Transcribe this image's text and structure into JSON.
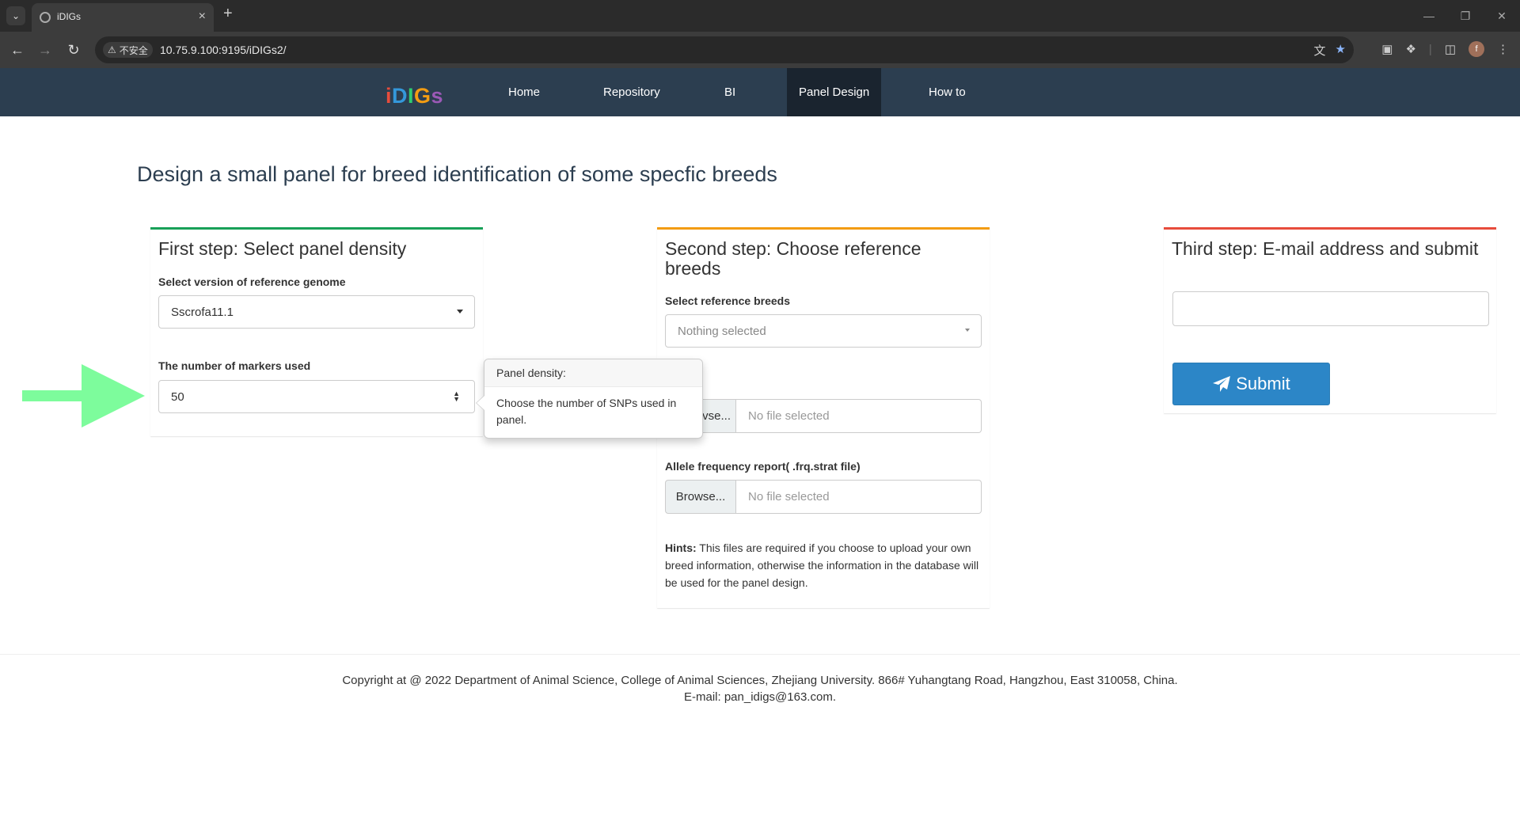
{
  "browser": {
    "tab_title": "iDIGs",
    "security_label": "不安全",
    "url": "10.75.9.100:9195/iDIGs2/",
    "avatar_letter": "f"
  },
  "brand": {
    "letters": [
      {
        "char": "i",
        "color": "#e74c3c"
      },
      {
        "char": "D",
        "color": "#3498db"
      },
      {
        "char": "I",
        "color": "#2ecc71"
      },
      {
        "char": "G",
        "color": "#f39c12"
      },
      {
        "char": "s",
        "color": "#9b59b6"
      }
    ]
  },
  "nav": {
    "home": "Home",
    "repository": "Repository",
    "bi": "BI",
    "panel_design": "Panel Design",
    "how_to": "How to",
    "active": "Panel Design"
  },
  "page": {
    "title": "Design a small panel for breed identification of some specfic breeds"
  },
  "step1": {
    "title": "First step: Select panel density",
    "color": "#18a058",
    "genome_label": "Select version of reference genome",
    "genome_value": "Sscrofa11.1",
    "markers_label": "The number of markers used",
    "markers_value": "50"
  },
  "step2": {
    "title": "Second step: Choose reference breeds",
    "color": "#f39c12",
    "breeds_label": "Select reference breeds",
    "breeds_value": "Nothing selected",
    "genotype_label_fragment": "e",
    "genotype_browse_fragment": "vse...",
    "genotype_file": "No file selected",
    "allele_label": "Allele frequency report( .frq.strat file)",
    "allele_browse": "Browse...",
    "allele_file": "No file selected",
    "hints_label": "Hints:",
    "hints_text": " This files are required if you choose to upload your own breed information, otherwise the information in the database will be used for the panel design."
  },
  "step3": {
    "title": "Third step: E-mail address and submit",
    "color": "#e74c3c",
    "email_value": "",
    "submit_label": "Submit"
  },
  "popover": {
    "title": "Panel density:",
    "content": "Choose the number of SNPs used in panel."
  },
  "annotation": {
    "arrow_color": "#7dfc9c"
  },
  "footer": {
    "copyright": "Copyright at @ 2022 Department of Animal Science, College of Animal Sciences, Zhejiang University. 866# Yuhangtang Road, Hangzhou, East 310058, China.",
    "email": "E-mail: pan_idigs@163.com."
  }
}
